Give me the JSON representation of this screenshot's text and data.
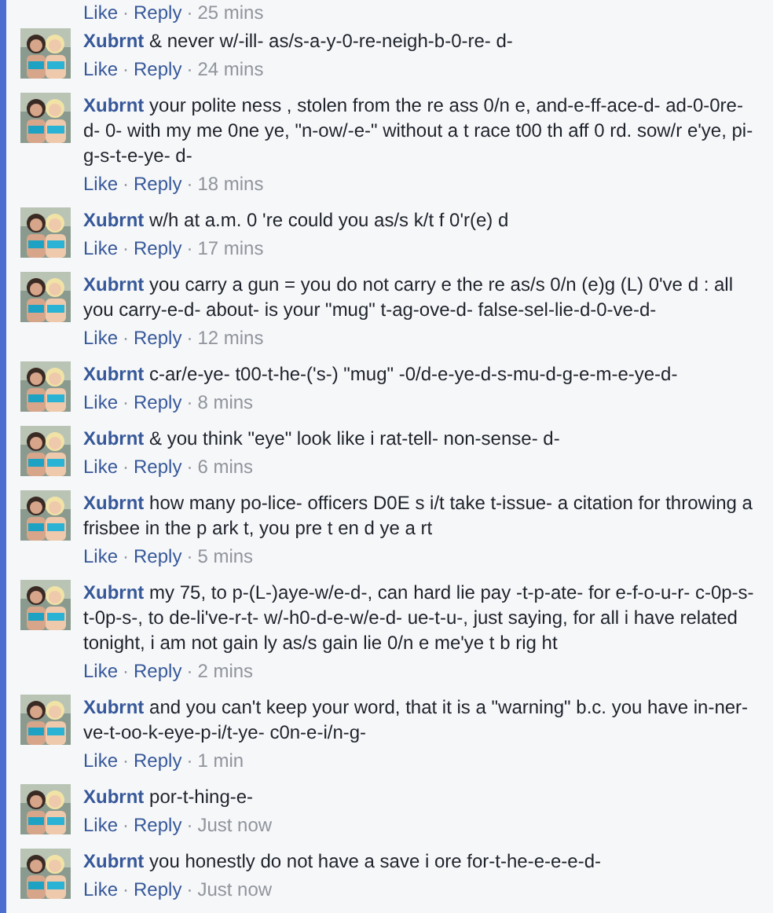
{
  "top_meta": [
    "Like",
    "·",
    "Reply",
    "·",
    "25 mins"
  ],
  "comments": [
    {
      "author": "Xubrnt",
      "text": "& never w/-ill- as/s-a-y-0-re-neigh-b-0-re- d-",
      "meta": [
        "Like",
        "·",
        "Reply",
        "·",
        "24 mins"
      ]
    },
    {
      "author": "Xubrnt",
      "text": "your polite ness , stolen from the re ass 0/n e, and-e-ff-ace-d- ad-0-0re-d- 0- with my me 0ne ye, \"n-ow/-e-\" without a t race t00 th aff 0 rd. sow/r e'ye, pi-g-s-t-e-ye- d-",
      "meta": [
        "Like",
        "·",
        "Reply",
        "·",
        "18 mins"
      ]
    },
    {
      "author": "Xubrnt",
      "text": "w/h at a.m. 0 're could you as/s k/t f 0'r(e) d",
      "meta": [
        "Like",
        "·",
        "Reply",
        "·",
        "17 mins"
      ]
    },
    {
      "author": "Xubrnt",
      "text": "you carry a gun = you do not carry e the re as/s 0/n (e)g (L) 0've d : all you carry-e-d- about- is your \"mug\" t-ag-ove-d- false-sel-lie-d-0-ve-d-",
      "meta": [
        "Like",
        "·",
        "Reply",
        "·",
        "12 mins"
      ]
    },
    {
      "author": "Xubrnt",
      "text": "c-ar/e-ye- t00-t-he-('s-) \"mug\" -0/d-e-ye-d-s-mu-d-g-e-m-e-ye-d-",
      "meta": [
        "Like",
        "·",
        "Reply",
        "·",
        "8 mins"
      ]
    },
    {
      "author": "Xubrnt",
      "text": "& you think \"eye\" look like i rat-tell- non-sense- d-",
      "meta": [
        "Like",
        "·",
        "Reply",
        "·",
        "6 mins"
      ]
    },
    {
      "author": "Xubrnt",
      "text": "how many po-lice- officers D0E s i/t take t-issue- a citation for throwing a frisbee in the p ark t, you pre t en d ye a rt",
      "meta": [
        "Like",
        "·",
        "Reply",
        "·",
        "5 mins"
      ]
    },
    {
      "author": "Xubrnt",
      "text": "my 75, to p-(L-)aye-w/e-d-, can hard lie pay -t-p-ate- for e-f-o-u-r- c-0p-s-t-0p-s-, to de-li've-r-t- w/-h0-d-e-w/e-d- ue-t-u-, just saying, for all i have related tonight, i am not gain ly as/s gain lie 0/n e me'ye t b rig ht",
      "meta": [
        "Like",
        "·",
        "Reply",
        "·",
        "2 mins"
      ]
    },
    {
      "author": "Xubrnt",
      "text": "and you can't keep your word, that it is a \"warning\" b.c. you have in-ner-ve-t-oo-k-eye-p-i/t-ye- c0n-e-i/n-g-",
      "meta": [
        "Like",
        "·",
        "Reply",
        "·",
        "1 min"
      ]
    },
    {
      "author": "Xubrnt",
      "text": "por-t-hing-e-",
      "meta": [
        "Like",
        "·",
        "Reply",
        "·",
        "Just now"
      ]
    },
    {
      "author": "Xubrnt",
      "text": "you honestly do not have a save i ore for-t-he-e-e-e-d-",
      "meta": [
        "Like",
        "·",
        "Reply",
        "·",
        "Just now"
      ]
    }
  ]
}
